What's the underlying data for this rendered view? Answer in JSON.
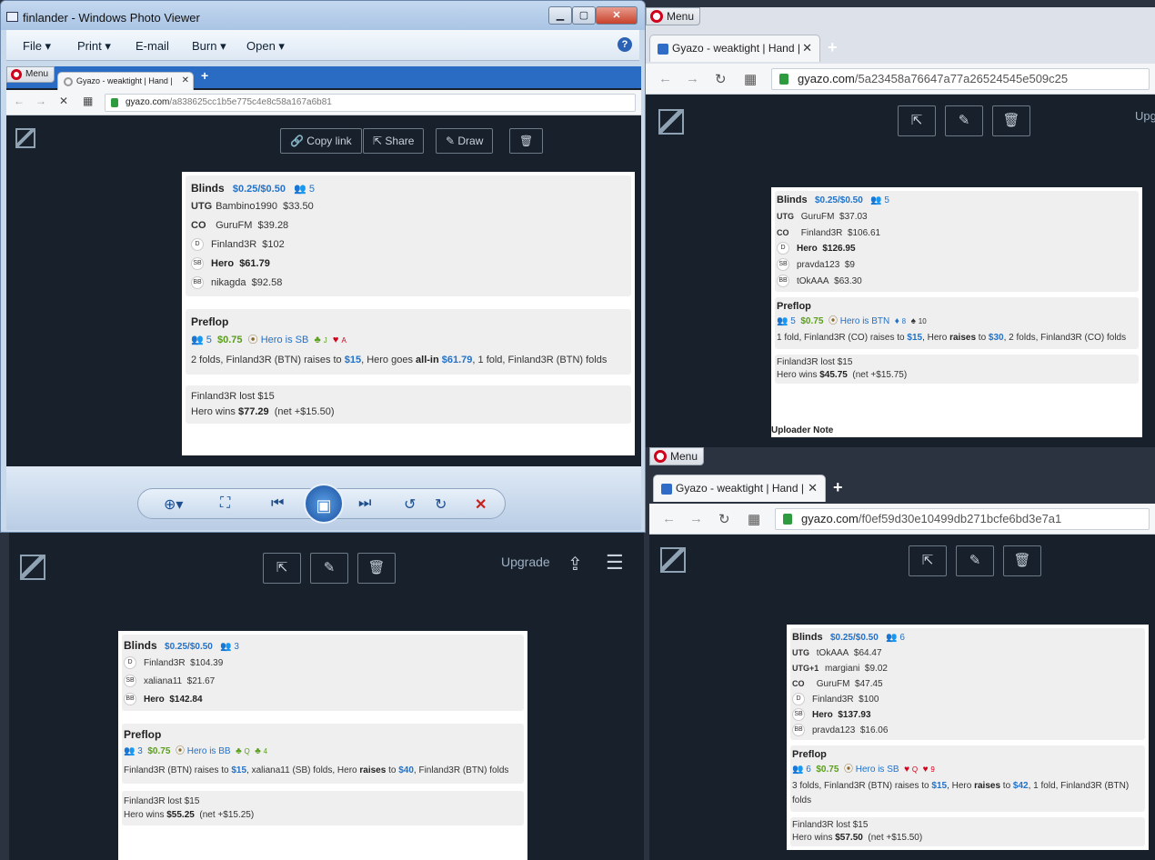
{
  "photo_viewer": {
    "title": "finlander - Windows Photo Viewer",
    "menu": [
      "File ▾",
      "Print ▾",
      "E-mail",
      "Burn ▾",
      "Open ▾"
    ],
    "caption_buttons": [
      "▁",
      "▢",
      "✕"
    ],
    "help": "?",
    "browser": {
      "opera_menu": "Menu",
      "tab_title": "Gyazo - weaktight | Hand |",
      "url_host": "gyazo.com",
      "url_path": "/a838625cc1b5e775c4e8c58a167a6b81"
    },
    "toolbar": {
      "copy_link": "Copy link",
      "share": "Share",
      "draw": "Draw"
    },
    "hand": {
      "blinds_title": "Blinds",
      "stakes": "$0.25/$0.50",
      "players": "5",
      "seats": [
        {
          "pos": "UTG",
          "name": "Bambino1990",
          "stack": "$33.50"
        },
        {
          "pos": "CO",
          "name": "GuruFM",
          "stack": "$39.28"
        },
        {
          "pos": "D",
          "name": "Finland3R",
          "stack": "$102"
        },
        {
          "pos": "SB",
          "name": "Hero",
          "stack": "$61.79"
        },
        {
          "pos": "BB",
          "name": "nikagda",
          "stack": "$92.58"
        }
      ],
      "preflop_title": "Preflop",
      "pf_players": "5",
      "pot": "$0.75",
      "hero_pos": "Hero is SB",
      "card1": "J",
      "card2": "A",
      "action": [
        "2 folds, Finland3R (BTN) raises to ",
        "$15",
        ", Hero goes ",
        "all-in",
        " ",
        "$61.79",
        ", 1 fold, Finland3R (BTN) folds"
      ],
      "result1": "Finland3R lost $15",
      "result2_a": "Hero wins ",
      "result2_b": "$77.29",
      "result2_c": "(net +$15.50)"
    },
    "controls": [
      "⊕▾",
      "⛶",
      "⏮",
      "▣",
      "⏭",
      "↺",
      "↻",
      "✕"
    ]
  },
  "top_right": {
    "opera_menu": "Menu",
    "tab_title": "Gyazo - weaktight | Hand |",
    "url_host": "gyazo.com",
    "url_path": "/5a23458a76647a77a26524545e509c25",
    "upgrade": "Upg",
    "hand": {
      "blinds_title": "Blinds",
      "stakes": "$0.25/$0.50",
      "players": "5",
      "seats": [
        {
          "pos": "UTG",
          "name": "GuruFM",
          "stack": "$37.03"
        },
        {
          "pos": "CO",
          "name": "Finland3R",
          "stack": "$106.61"
        },
        {
          "pos": "D",
          "name": "Hero",
          "stack": "$126.95"
        },
        {
          "pos": "SB",
          "name": "pravda123",
          "stack": "$9"
        },
        {
          "pos": "BB",
          "name": "tOkAAA",
          "stack": "$63.30"
        }
      ],
      "preflop_title": "Preflop",
      "pf_players": "5",
      "pot": "$0.75",
      "hero_pos": "Hero is BTN",
      "card1": "8",
      "card2": "10",
      "action": [
        "1 fold, Finland3R (CO) raises to ",
        "$15",
        ", Hero ",
        "raises",
        " to ",
        "$30",
        ", 2 folds, Finland3R (CO) folds"
      ],
      "result1": "Finland3R lost $15",
      "result2_a": "Hero wins ",
      "result2_b": "$45.75",
      "result2_c": "(net +$15.75)",
      "uploader_note": "Uploader Note"
    }
  },
  "bottom_left": {
    "upgrade": "Upgrade",
    "hand": {
      "blinds_title": "Blinds",
      "stakes": "$0.25/$0.50",
      "players": "3",
      "seats": [
        {
          "pos": "D",
          "name": "Finland3R",
          "stack": "$104.39"
        },
        {
          "pos": "SB",
          "name": "xaliana11",
          "stack": "$21.67"
        },
        {
          "pos": "BB",
          "name": "Hero",
          "stack": "$142.84"
        }
      ],
      "preflop_title": "Preflop",
      "pf_players": "3",
      "pot": "$0.75",
      "hero_pos": "Hero is BB",
      "card1": "Q",
      "card2": "4",
      "action": [
        "Finland3R (BTN) raises to ",
        "$15",
        ", xaliana11 (SB) folds, Hero ",
        "raises",
        " to ",
        "$40",
        ", Finland3R (BTN) folds"
      ],
      "result1": "Finland3R lost $15",
      "result2_a": "Hero wins ",
      "result2_b": "$55.25",
      "result2_c": "(net +$15.25)"
    }
  },
  "bottom_right": {
    "opera_menu": "Menu",
    "tab_title": "Gyazo - weaktight | Hand |",
    "url_host": "gyazo.com",
    "url_path": "/f0ef59d30e10499db271bcfe6bd3e7a1",
    "hand": {
      "blinds_title": "Blinds",
      "stakes": "$0.25/$0.50",
      "players": "6",
      "seats": [
        {
          "pos": "UTG",
          "name": "tOkAAA",
          "stack": "$64.47"
        },
        {
          "pos": "UTG+1",
          "name": "margiani",
          "stack": "$9.02"
        },
        {
          "pos": "CO",
          "name": "GuruFM",
          "stack": "$47.45"
        },
        {
          "pos": "D",
          "name": "Finland3R",
          "stack": "$100"
        },
        {
          "pos": "SB",
          "name": "Hero",
          "stack": "$137.93"
        },
        {
          "pos": "BB",
          "name": "pravda123",
          "stack": "$16.06"
        }
      ],
      "preflop_title": "Preflop",
      "pf_players": "6",
      "pot": "$0.75",
      "hero_pos": "Hero is SB",
      "card1": "Q",
      "card2": "9",
      "action": [
        "3 folds, Finland3R (BTN) raises to ",
        "$15",
        ", Hero ",
        "raises",
        " to ",
        "$42",
        ", 1 fold, Finland3R (BTN) folds"
      ],
      "result1": "Finland3R lost $15",
      "result2_a": "Hero wins ",
      "result2_b": "$57.50",
      "result2_c": "(net +$15.50)"
    }
  }
}
